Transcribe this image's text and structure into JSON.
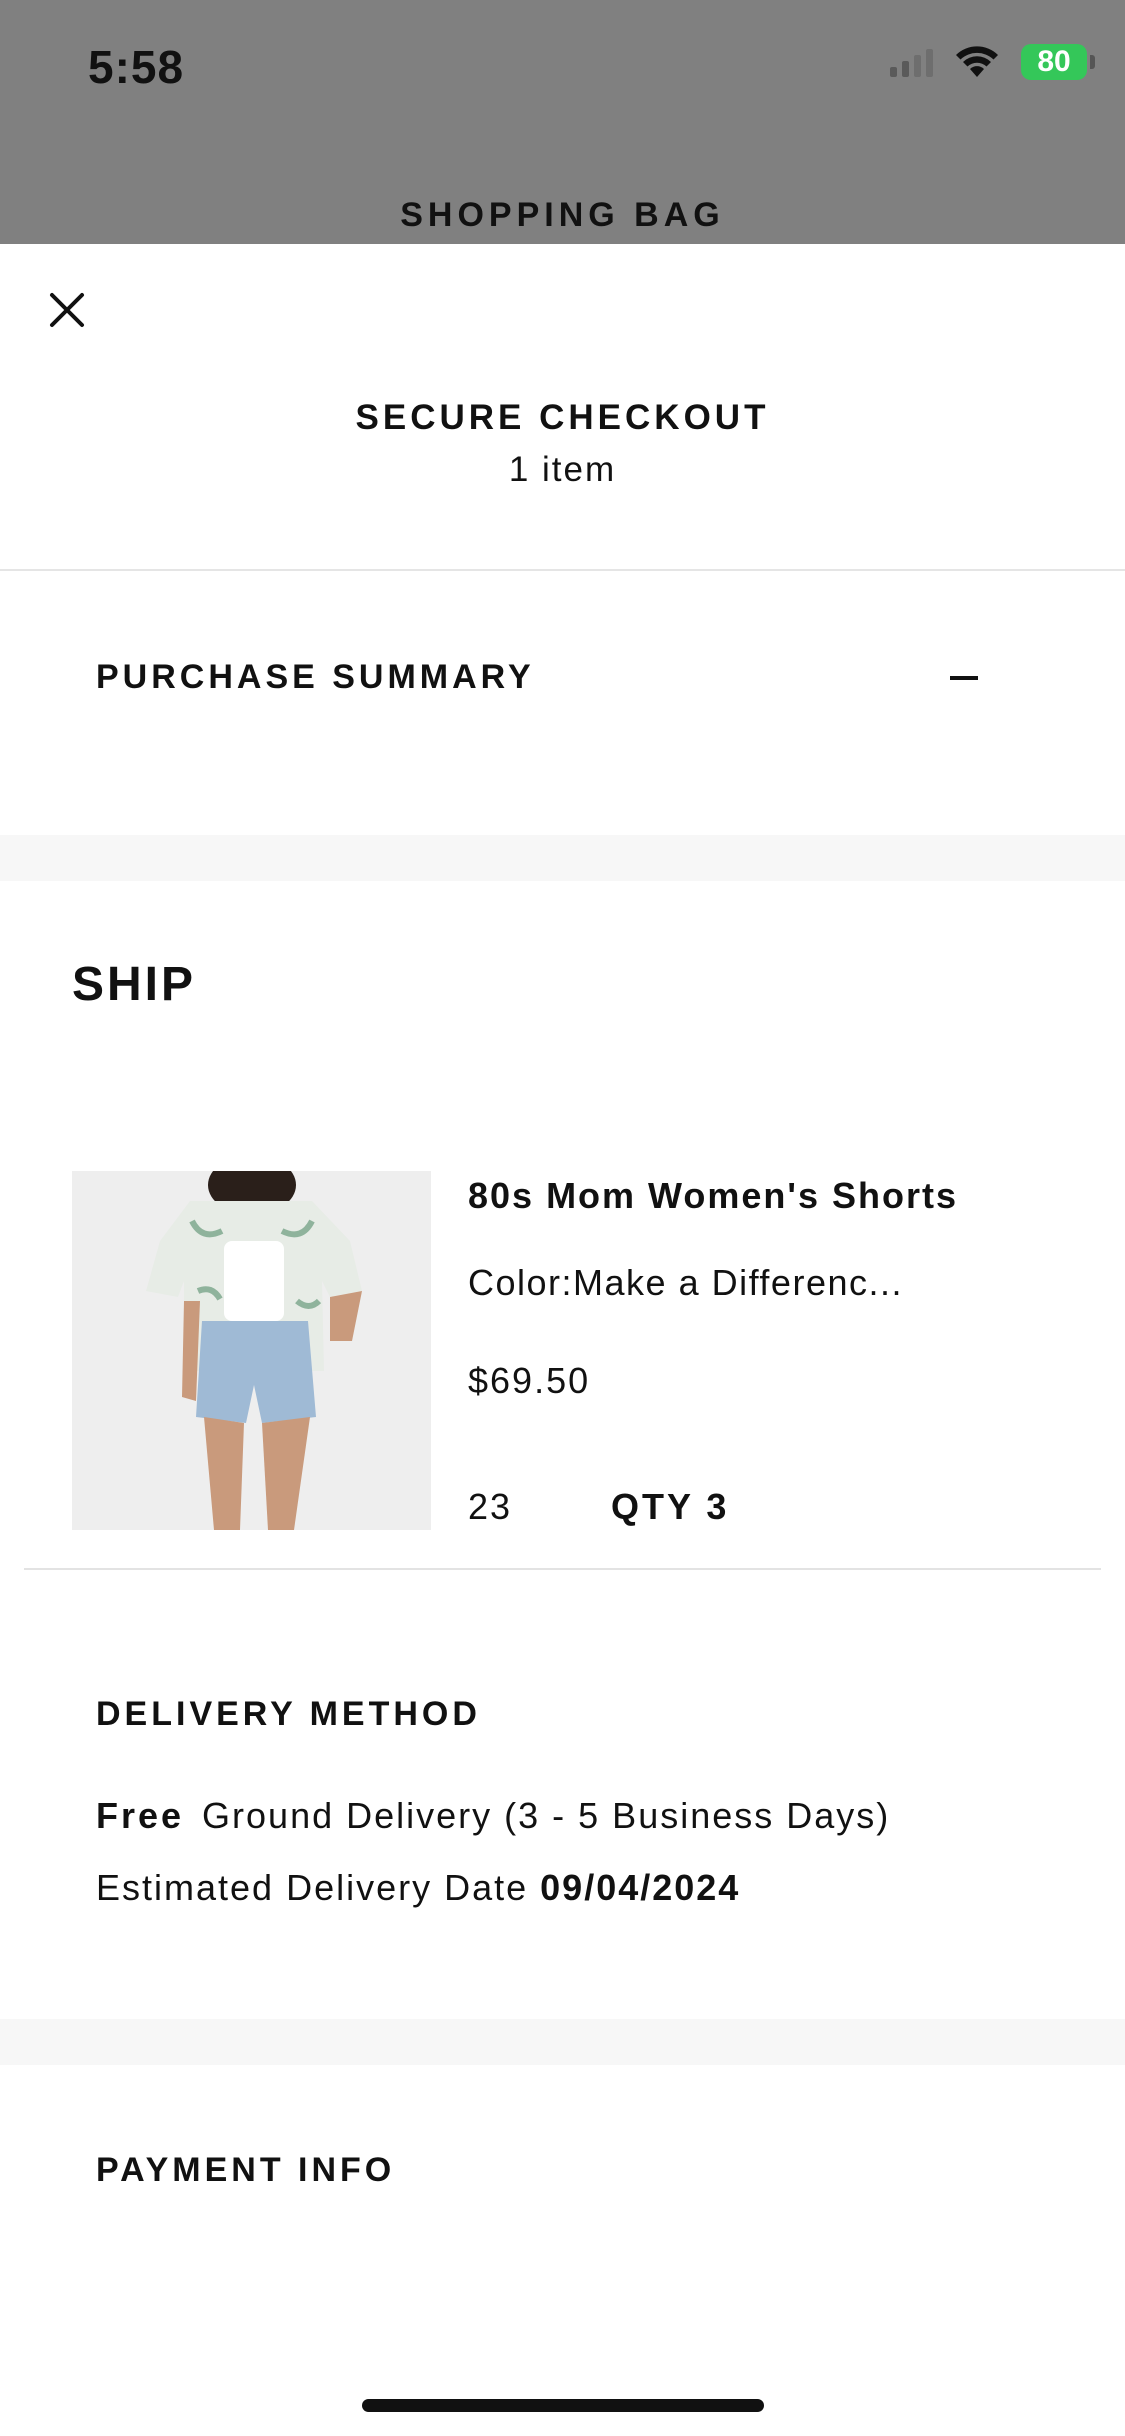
{
  "status_bar": {
    "time": "5:58",
    "battery_percent": "80",
    "icons": [
      "cellular-signal-icon",
      "wifi-icon",
      "battery-charging-icon"
    ]
  },
  "background": {
    "title": "SHOPPING BAG"
  },
  "sheet": {
    "close_icon": "close-icon",
    "title": "SECURE CHECKOUT",
    "item_count": "1 item"
  },
  "purchase_summary": {
    "label": "PURCHASE SUMMARY",
    "toggle_icon": "minus-icon"
  },
  "ship": {
    "heading": "SHIP",
    "item": {
      "name": "80s Mom Women's Shorts",
      "color": "Color:Make a Differenc...",
      "price": "$69.50",
      "size": "23",
      "qty": "QTY 3"
    }
  },
  "delivery": {
    "heading": "DELIVERY METHOD",
    "cost": "Free",
    "method": "Ground Delivery (3 - 5 Business Days)",
    "estimate_label": "Estimated Delivery Date",
    "estimate_date": "09/04/2024"
  },
  "payment": {
    "heading": "PAYMENT INFO"
  },
  "colors": {
    "backdrop": "#808080",
    "text": "#111111",
    "band": "#f7f7f7",
    "battery": "#34c759"
  }
}
